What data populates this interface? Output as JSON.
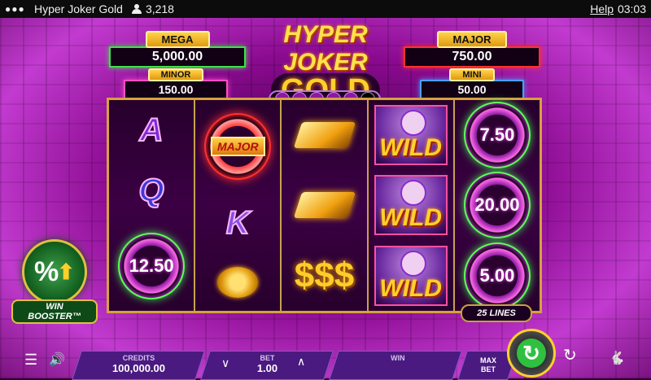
{
  "topbar": {
    "title": "Hyper Joker Gold",
    "players": "3,218",
    "help": "Help",
    "clock": "03:03"
  },
  "jackpots": {
    "mega": {
      "label": "MEGA",
      "value": "5,000.00"
    },
    "minor": {
      "label": "MINOR",
      "value": "150.00"
    },
    "major": {
      "label": "MAJOR",
      "value": "750.00"
    },
    "mini": {
      "label": "MINI",
      "value": "50.00"
    }
  },
  "logo": {
    "line1": "HYPER JOKER",
    "line2": "GOLD"
  },
  "progress": {
    "filled": 5,
    "total": 6
  },
  "reels": {
    "r1": {
      "top": "A",
      "mid": "Q",
      "chip": "12.50"
    },
    "r2": {
      "major_label": "MAJOR",
      "mid": "K"
    },
    "r3": {
      "bottom": "$$$"
    },
    "r4": {
      "wild": "WILD"
    },
    "r5": {
      "c1": "7.50",
      "c2": "20.00",
      "c3": "5.00"
    }
  },
  "lines_badge": "25 LINES",
  "booster": {
    "label": "WIN BOOSTER™"
  },
  "controls": {
    "credits_label": "CREDITS",
    "credits_value": "100,000.00",
    "bet_label": "BET",
    "bet_value": "1.00",
    "win_label": "WIN",
    "win_value": "",
    "max_bet_line1": "MAX",
    "max_bet_line2": "BET"
  },
  "icons": {
    "menu": "hamburger-icon",
    "sound": "speaker-icon",
    "bet_down": "chevron-down-icon",
    "bet_up": "chevron-up-icon",
    "spin": "spin-icon",
    "autoplay": "autoplay-icon",
    "turbo": "turbo-icon"
  },
  "colors": {
    "gold": "#ffd02a",
    "mega_border": "#3fe04a",
    "minor_border": "#ff4fc4",
    "major_border": "#ff3030",
    "mini_border": "#4aa0ff"
  }
}
